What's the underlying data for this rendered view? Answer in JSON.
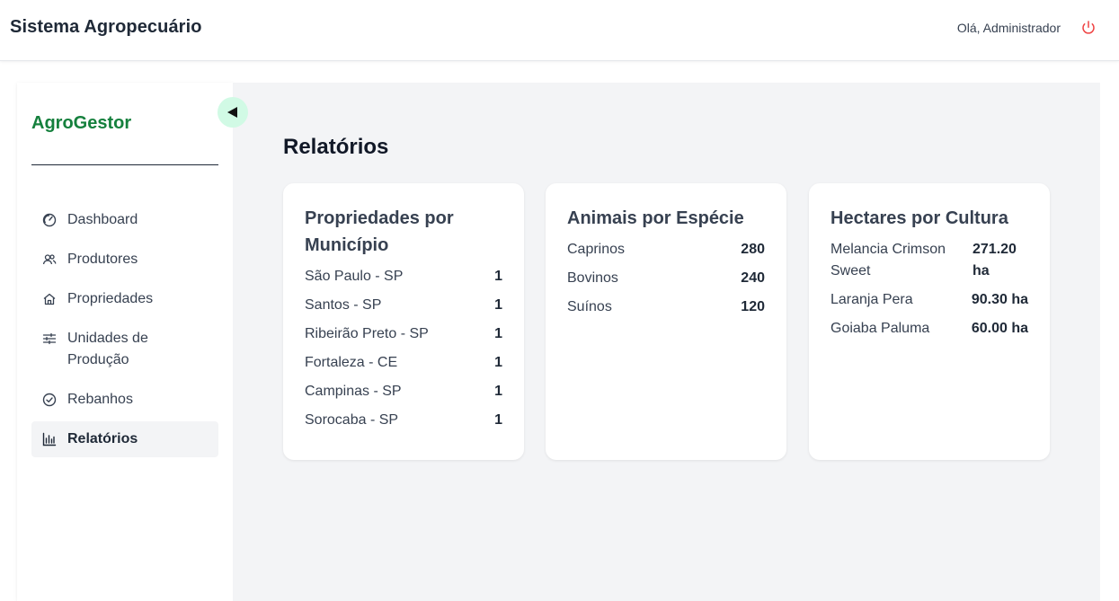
{
  "header": {
    "title": "Sistema Agropecuário",
    "greeting": "Olá, Administrador",
    "logout_icon": "power-icon",
    "logout_color": "#ef4444"
  },
  "sidebar": {
    "brand": "AgroGestor",
    "brand_color": "#15803d",
    "collapse_icon": "triangle-left-icon",
    "items": [
      {
        "label": "Dashboard",
        "icon": "dashboard-icon",
        "active": false
      },
      {
        "label": "Produtores",
        "icon": "users-icon",
        "active": false
      },
      {
        "label": "Propriedades",
        "icon": "home-icon",
        "active": false
      },
      {
        "label": "Unidades de Produção",
        "icon": "sliders-icon",
        "active": false
      },
      {
        "label": "Rebanhos",
        "icon": "check-circle-icon",
        "active": false
      },
      {
        "label": "Relatórios",
        "icon": "bar-chart-icon",
        "active": true
      }
    ]
  },
  "main": {
    "title": "Relatórios",
    "cards": [
      {
        "title": "Propriedades por Município",
        "rows": [
          {
            "key": "São Paulo - SP",
            "value": "1"
          },
          {
            "key": "Santos - SP",
            "value": "1"
          },
          {
            "key": "Ribeirão Preto - SP",
            "value": "1"
          },
          {
            "key": "Fortaleza - CE",
            "value": "1"
          },
          {
            "key": "Campinas - SP",
            "value": "1"
          },
          {
            "key": "Sorocaba - SP",
            "value": "1"
          }
        ]
      },
      {
        "title": "Animais por Espécie",
        "rows": [
          {
            "key": "Caprinos",
            "value": "280"
          },
          {
            "key": "Bovinos",
            "value": "240"
          },
          {
            "key": "Suínos",
            "value": "120"
          }
        ]
      },
      {
        "title": "Hectares por Cultura",
        "rows": [
          {
            "key": "Melancia Crimson Sweet",
            "value": "271.20 ha"
          },
          {
            "key": "Laranja Pera",
            "value": "90.30 ha"
          },
          {
            "key": "Goiaba Paluma",
            "value": "60.00 ha"
          }
        ]
      }
    ]
  }
}
